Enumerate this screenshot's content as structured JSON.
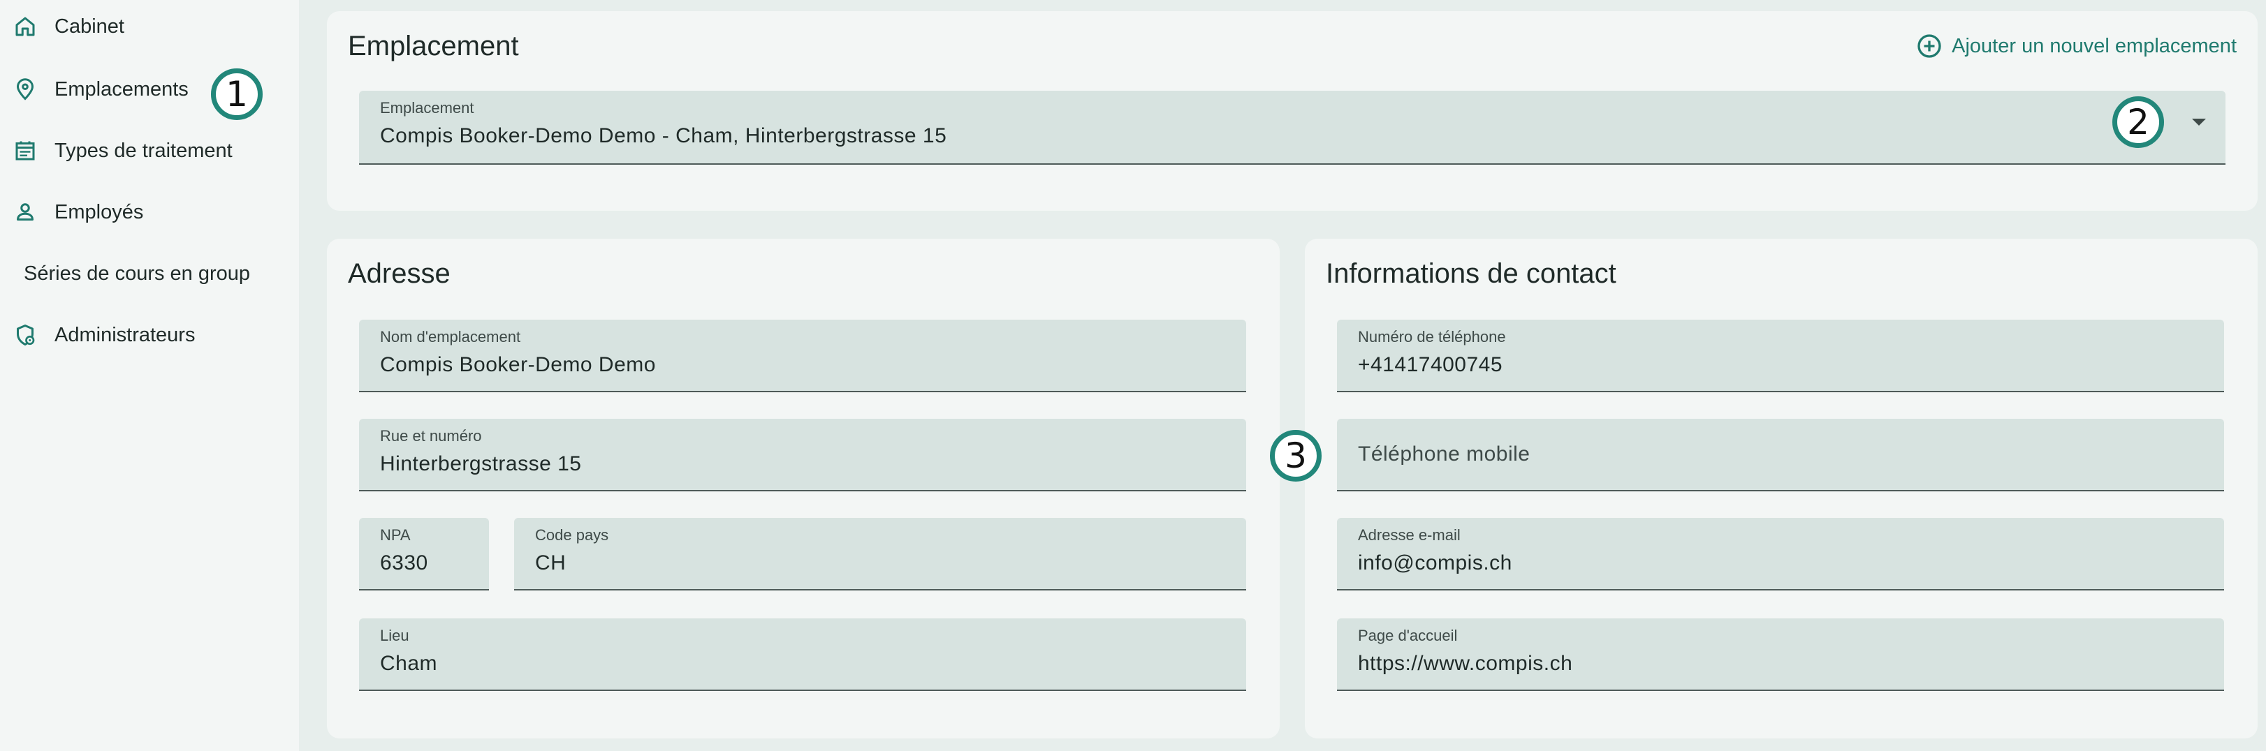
{
  "sidebar": {
    "items": [
      {
        "label": "Cabinet",
        "icon": "home-icon"
      },
      {
        "label": "Emplacements",
        "icon": "location-pin-icon"
      },
      {
        "label": "Types de traitement",
        "icon": "calendar-list-icon"
      },
      {
        "label": "Employés",
        "icon": "person-icon"
      },
      {
        "label": "Séries de cours en group",
        "icon": ""
      },
      {
        "label": "Administrateurs",
        "icon": "admin-shield-icon"
      }
    ]
  },
  "location_card": {
    "title": "Emplacement",
    "add_button": "Ajouter un nouvel emplacement",
    "select": {
      "label": "Emplacement",
      "value": "Compis Booker-Demo Demo - Cham, Hinterbergstrasse 15"
    }
  },
  "address_card": {
    "title": "Adresse",
    "name": {
      "label": "Nom d'emplacement",
      "value": "Compis Booker-Demo Demo"
    },
    "street": {
      "label": "Rue et numéro",
      "value": "Hinterbergstrasse 15"
    },
    "zip": {
      "label": "NPA",
      "value": "6330"
    },
    "country": {
      "label": "Code pays",
      "value": "CH"
    },
    "city": {
      "label": "Lieu",
      "value": "Cham"
    }
  },
  "contact_card": {
    "title": "Informations de contact",
    "phone": {
      "label": "Numéro de téléphone",
      "value": "+41417400745"
    },
    "mobile": {
      "placeholder": "Téléphone mobile"
    },
    "email": {
      "label": "Adresse e-mail",
      "value": "info@compis.ch"
    },
    "homepage": {
      "label": "Page d'accueil",
      "value": "https://www.compis.ch"
    }
  },
  "callouts": [
    "1",
    "2",
    "3"
  ],
  "colors": {
    "accent": "#1f7a6e",
    "callout_border": "#22877a",
    "field_bg": "#d7e3e0",
    "page_bg": "#e7eeec"
  }
}
